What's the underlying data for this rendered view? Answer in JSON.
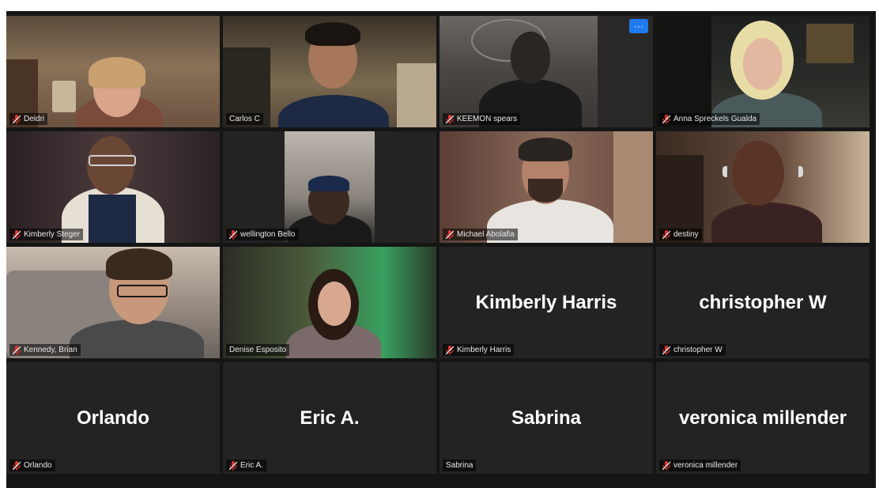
{
  "participants": [
    {
      "name": "Deidri",
      "video": true
    },
    {
      "name": "Carlos C",
      "video": true
    },
    {
      "name": "KEEMON spears",
      "video": true,
      "more_button": "···"
    },
    {
      "name": "Anna Spreckels Gualda",
      "video": true
    },
    {
      "name": "Kimberly Steger",
      "video": true
    },
    {
      "name": "wellington Bello",
      "video": true
    },
    {
      "name": "Michael Abolafia",
      "video": true
    },
    {
      "name": "destiny",
      "video": true
    },
    {
      "name": "Kennedy, Brian",
      "video": true
    },
    {
      "name": "Denise Esposito",
      "video": true,
      "active_speaker": true
    },
    {
      "name": "Kimberly Harris",
      "video": false,
      "display_name": "Kimberly Harris"
    },
    {
      "name": "christopher W",
      "video": false,
      "display_name": "christopher W"
    },
    {
      "name": "Orlando",
      "video": false,
      "display_name": "Orlando"
    },
    {
      "name": "Eric A.",
      "video": false,
      "display_name": "Eric A."
    },
    {
      "name": "Sabrina",
      "video": false,
      "display_name": "Sabrina",
      "muted": false
    },
    {
      "name": "veronica millender",
      "video": false,
      "display_name": "veronica millender"
    }
  ],
  "colors": {
    "active_speaker_border": "#d7e23a",
    "muted_icon": "#e0332f",
    "tile_background": "#232323",
    "more_button": "#1f7af0"
  }
}
